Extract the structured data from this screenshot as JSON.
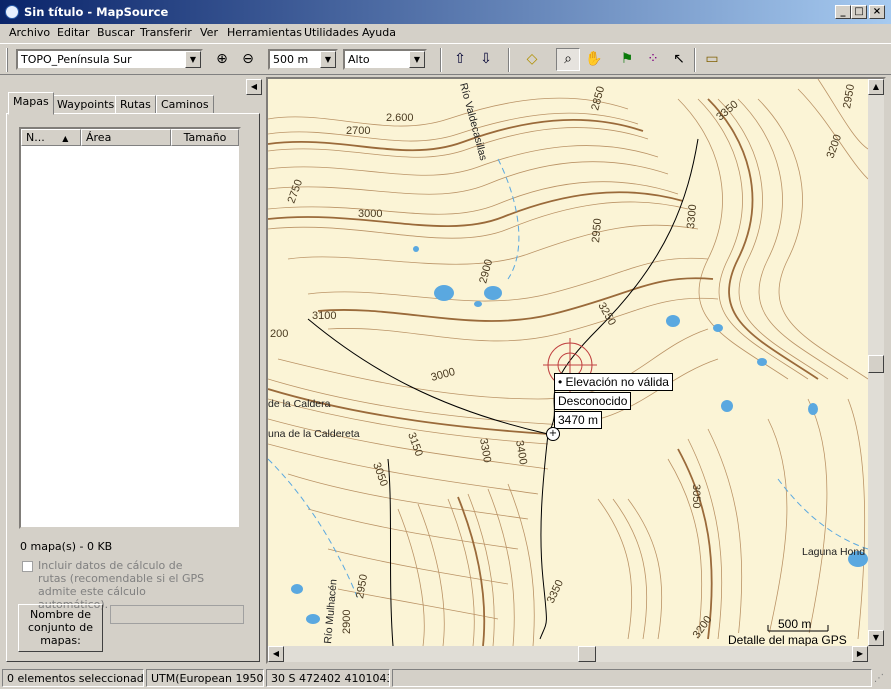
{
  "window": {
    "title": "Sin título - MapSource",
    "minimize": "_",
    "maximize": "□",
    "close": "×"
  },
  "menu": [
    "Archivo",
    "Editar",
    "Buscar",
    "Transferir",
    "Ver",
    "Herramientas",
    "Utilidades",
    "Ayuda"
  ],
  "toolbar": {
    "product_select": "TOPO_Península Sur",
    "scale_select": "500 m",
    "detail_select": "Alto",
    "icons": [
      "zoom-in-icon",
      "zoom-out-icon",
      "receive-from-device-icon",
      "send-to-device-icon",
      "map-tool-icon",
      "zoom-tool-icon",
      "hand-tool-icon",
      "waypoint-tool-icon",
      "route-tool-icon",
      "selection-tool-icon",
      "distance-tool-icon"
    ]
  },
  "left_panel": {
    "tabs": [
      "Mapas",
      "Waypoints",
      "Rutas",
      "Caminos"
    ],
    "active_tab": "Mapas",
    "columns": [
      "N...",
      "Área",
      "Tamaño"
    ],
    "summary": "0 mapa(s) - 0 KB",
    "checkbox_label": "Incluir datos de cálculo de rutas (recomendable si el GPS admite este cálculo automático).",
    "mapset_button": "Nombre de conjunto de mapas:",
    "mapset_value": ""
  },
  "map": {
    "contour_labels": [
      "2850",
      "2700",
      "2.600",
      "2750",
      "3000",
      "2900",
      "2950",
      "3300",
      "3350",
      "3200",
      "3100",
      "200",
      "3000",
      "3250",
      "3150",
      "3300",
      "3400",
      "3050",
      "3050",
      "2950",
      "2900",
      "3350",
      "3200",
      "2950"
    ],
    "place_labels": [
      "Río Valdecasillas",
      "de la Caldera",
      "una de la Caldereta",
      "Laguna Hond",
      "Río Mulhacén"
    ],
    "tooltip": {
      "line1": "Elevación no válida",
      "line2": "Desconocido",
      "line3": "3470 m"
    },
    "scale_label": "500 m",
    "detail_label": "Detalle del mapa GPS"
  },
  "status": {
    "selection": "0 elementos seleccionados",
    "datum": "UTM(European 1950)",
    "coords": "30 S 472402 4101043",
    "extra": ""
  }
}
